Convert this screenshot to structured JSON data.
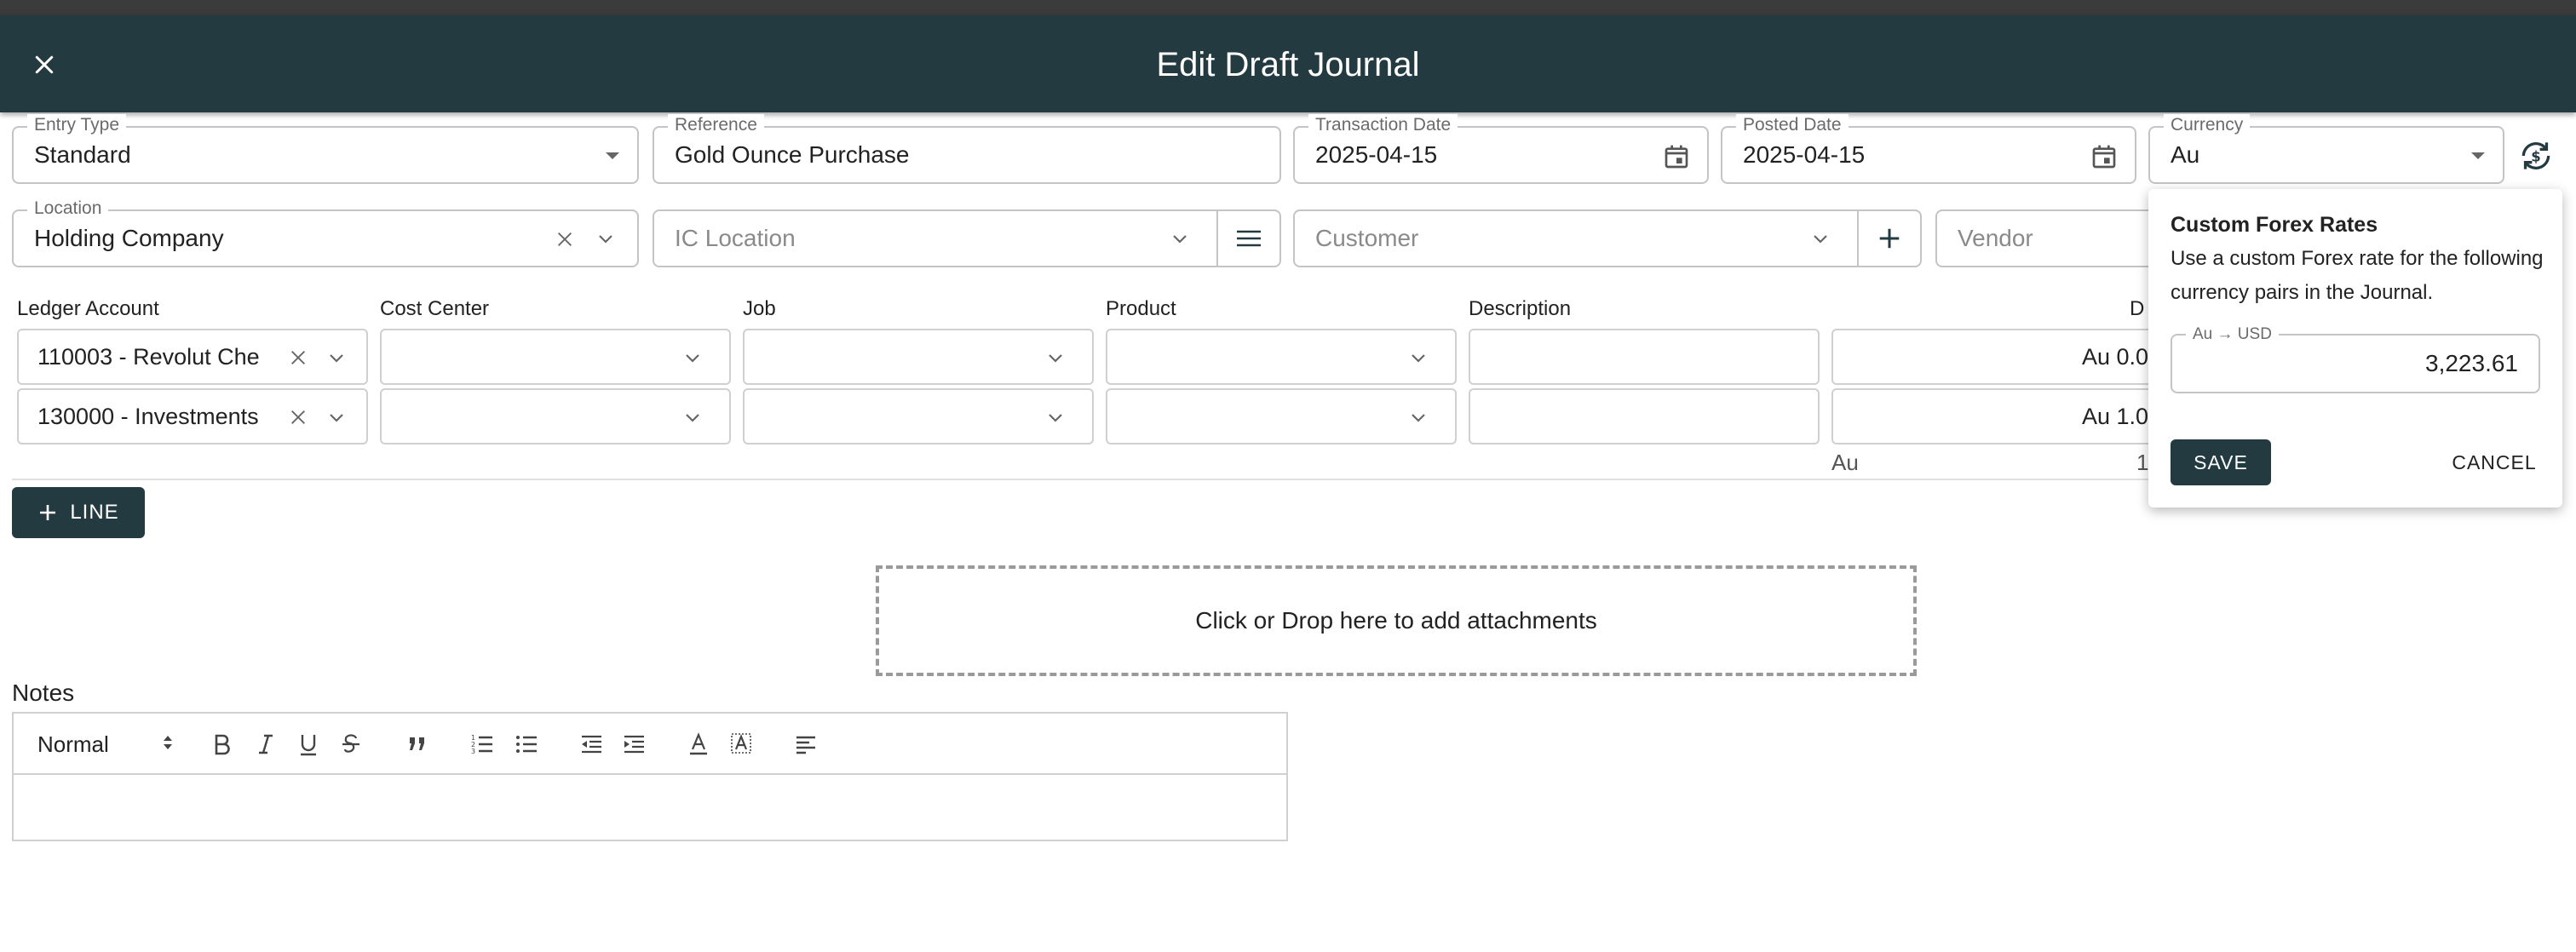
{
  "window": {
    "title": "Edit Draft Journal"
  },
  "form": {
    "entry_type": {
      "label": "Entry Type",
      "value": "Standard"
    },
    "reference": {
      "label": "Reference",
      "value": "Gold Ounce Purchase"
    },
    "transaction_date": {
      "label": "Transaction Date",
      "value": "2025-04-15"
    },
    "posted_date": {
      "label": "Posted Date",
      "value": "2025-04-15"
    },
    "currency": {
      "label": "Currency",
      "value": "Au"
    },
    "location": {
      "label": "Location",
      "value": "Holding Company"
    },
    "ic_location": {
      "placeholder": "IC Location"
    },
    "customer": {
      "placeholder": "Customer"
    },
    "vendor": {
      "placeholder": "Vendor"
    }
  },
  "table": {
    "columns": [
      "Ledger Account",
      "Cost Center",
      "Job",
      "Product",
      "Description",
      "D"
    ],
    "rows": [
      {
        "ledger_account": "110003 - Revolut Che",
        "amount": "Au 0.0"
      },
      {
        "ledger_account": "130000 - Investments",
        "amount": "Au 1.0"
      }
    ],
    "total_currency": "Au",
    "total_value": "1"
  },
  "actions": {
    "add_line_label": "LINE"
  },
  "attachments": {
    "label": "Click or Drop here to add attachments"
  },
  "notes": {
    "label": "Notes",
    "format_value": "Normal"
  },
  "forex_popover": {
    "title": "Custom Forex Rates",
    "description": "Use a custom Forex rate for the following currency pairs in the Journal.",
    "pair_label": "Au → USD",
    "rate": "3,223.61",
    "save_label": "SAVE",
    "cancel_label": "CANCEL"
  },
  "colors": {
    "primary": "#233a41",
    "border": "#c4c4c4"
  }
}
